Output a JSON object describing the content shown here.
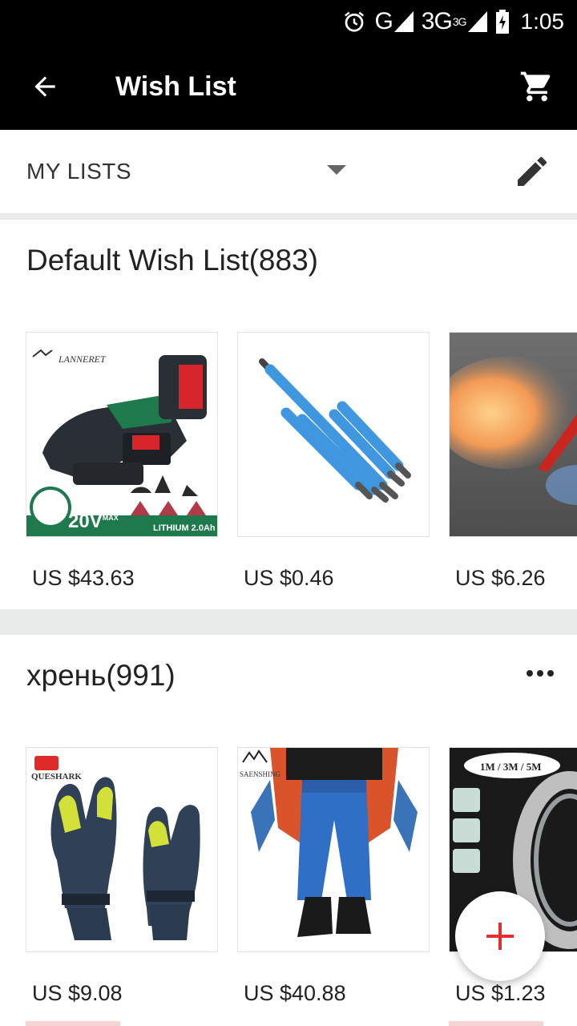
{
  "status_bar": {
    "network_signal_label": "G",
    "network_3g_label": "3G",
    "network_3g_sup": "3G",
    "time": "1:05",
    "icons": [
      "alarm-icon",
      "signal-icon",
      "battery-icon"
    ]
  },
  "app_bar": {
    "title": "Wish List",
    "back_icon": "arrow-left-icon",
    "cart_icon": "cart-icon"
  },
  "list_selector": {
    "label": "MY LISTS",
    "dropdown_icon": "triangle-down-icon",
    "edit_icon": "pencil-icon"
  },
  "wish_lists": [
    {
      "title": "Default Wish List(883)",
      "items": [
        {
          "price": "US $43.63",
          "image": "oscillating multi-tool kit",
          "brand": "LANNERET",
          "badge": "20V",
          "badge_sup": "MAX",
          "badge_note": "LITHIUM 2.0Ah"
        },
        {
          "price": "US $0.46",
          "image": "blue screwdriver bits"
        },
        {
          "price": "US $6.26",
          "image": "torch flame"
        }
      ]
    },
    {
      "title": "хрень(991)",
      "more_icon": "more-horizontal-icon",
      "items": [
        {
          "price": "US $9.08",
          "image": "ski mittens",
          "brand": "QUESHARK"
        },
        {
          "price": "US $40.88",
          "image": "blue ski pants",
          "brand": "SAENSHING"
        },
        {
          "price": "US $1.23",
          "image": "double-sided tape",
          "brand": "1M / 3M / 5M"
        }
      ]
    }
  ],
  "fab": {
    "icon": "plus-icon"
  },
  "colors": {
    "accent": "#e62e2e",
    "bar": "#000000",
    "background": "#e9ebea"
  }
}
